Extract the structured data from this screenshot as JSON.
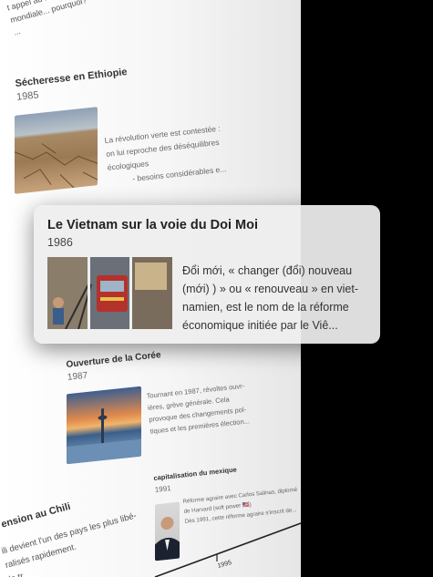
{
  "background_page": {
    "top_snippet": [
      "t appel au FMI, en état d'urgence",
      "mondiale... pourquoi?",
      "..."
    ],
    "sechresse": {
      "title": "Sécheresse en Ethiopie",
      "year": "1985",
      "lines": [
        "La révolution verte est contestée :",
        "on lui reproche des déséquilibres",
        "écologiques",
        "- besoins considérables e..."
      ]
    },
    "coree": {
      "title": "Ouverture de la Corée",
      "year": "1987",
      "lines": [
        "Tournant en 1987, révoltes ouvr-",
        "ières, grève générale. Cela",
        "provoque des changements pol-",
        "tiques et les premières élection..."
      ]
    },
    "mexique": {
      "title": "capitalisation du mexique",
      "year": "1991",
      "lines": [
        "Réforme agraire avec Carlos Salinas, diplomé",
        "de Harvard (soft power 🇺🇸)",
        "",
        "Dès 1991, cette réforme agraire s'inscrit de..."
      ]
    },
    "chili": {
      "title": "ension au Chili",
      "lines": [
        "ili devient l'un des pays les plus libé-",
        "ralisés rapidement."
      ],
      "tail": "le tr"
    },
    "axis_year": "1995"
  },
  "card": {
    "title": "Le Vietnam sur la voie du Doi Moi",
    "year": "1986",
    "description": "Đổi mới, « changer (đổi) nouveau (mới) ) » ou « renouveau » en viet-namien, est le nom de la réforme économique initiée par le Viê..."
  }
}
